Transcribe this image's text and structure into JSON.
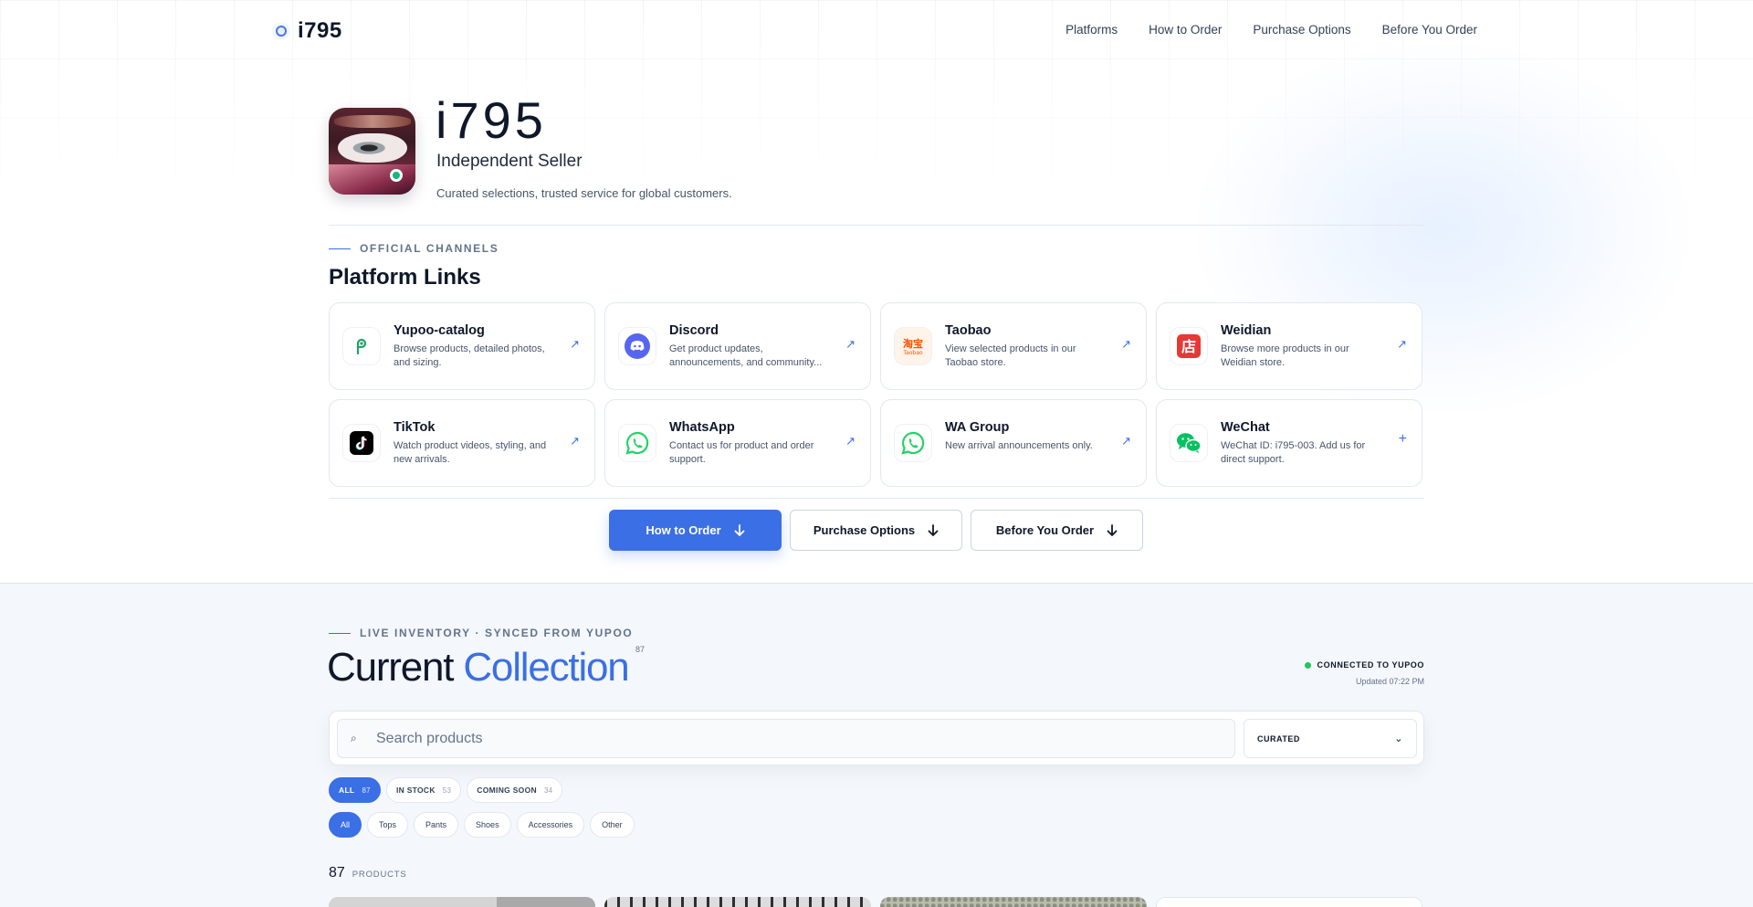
{
  "brand": {
    "name": "i795"
  },
  "nav": {
    "links": [
      "Platforms",
      "How to Order",
      "Purchase Options",
      "Before You Order"
    ]
  },
  "hero": {
    "title": "i795",
    "subtitle": "Independent Seller",
    "description": "Curated selections, trusted service for global customers."
  },
  "platforms": {
    "eyebrow": "OFFICIAL CHANNELS",
    "title": "Platform Links",
    "items": [
      {
        "name": "Yupoo-catalog",
        "desc": "Browse products, detailed photos, and sizing.",
        "icon": "yupoo-icon",
        "action": "↗"
      },
      {
        "name": "Discord",
        "desc": "Get product updates, announcements, and community...",
        "icon": "discord-icon",
        "action": "↗"
      },
      {
        "name": "Taobao",
        "desc": "View selected products in our Taobao store.",
        "icon": "taobao-icon",
        "action": "↗"
      },
      {
        "name": "Weidian",
        "desc": "Browse more products in our Weidian store.",
        "icon": "weidian-icon",
        "action": "↗"
      },
      {
        "name": "TikTok",
        "desc": "Watch product videos, styling, and new arrivals.",
        "icon": "tiktok-icon",
        "action": "↗"
      },
      {
        "name": "WhatsApp",
        "desc": "Contact us for product and order support.",
        "icon": "whatsapp-icon",
        "action": "↗"
      },
      {
        "name": "WA Group",
        "desc": "New arrival announcements only.",
        "icon": "whatsapp-icon",
        "action": "↗"
      },
      {
        "name": "WeChat",
        "desc": "WeChat ID: i795-003. Add us for direct support.",
        "icon": "wechat-icon",
        "action": "+"
      }
    ]
  },
  "actions": [
    {
      "label": "How to Order",
      "primary": true
    },
    {
      "label": "Purchase Options",
      "primary": false
    },
    {
      "label": "Before You Order",
      "primary": false
    }
  ],
  "collection": {
    "eyebrow": "LIVE INVENTORY · SYNCED FROM YUPOO",
    "title_plain": "Current",
    "title_accent": "Collection",
    "count_sup": "87",
    "status": "CONNECTED TO YUPOO",
    "updated": "Updated 07:22 PM",
    "search_placeholder": "Search products",
    "sort_value": "CURATED",
    "stock_filters": [
      {
        "label": "ALL",
        "count": "87",
        "active": true
      },
      {
        "label": "IN STOCK",
        "count": "53",
        "active": false
      },
      {
        "label": "COMING SOON",
        "count": "34",
        "active": false
      }
    ],
    "categories": [
      {
        "label": "All",
        "active": true
      },
      {
        "label": "Tops",
        "active": false
      },
      {
        "label": "Pants",
        "active": false
      },
      {
        "label": "Shoes",
        "active": false
      },
      {
        "label": "Accessories",
        "active": false
      },
      {
        "label": "Other",
        "active": false
      }
    ],
    "product_count": "87",
    "product_count_label": "PRODUCTS"
  },
  "colors": {
    "accent": "#3b6fe6",
    "status_green": "#22c55e",
    "text": "#0f172a"
  }
}
